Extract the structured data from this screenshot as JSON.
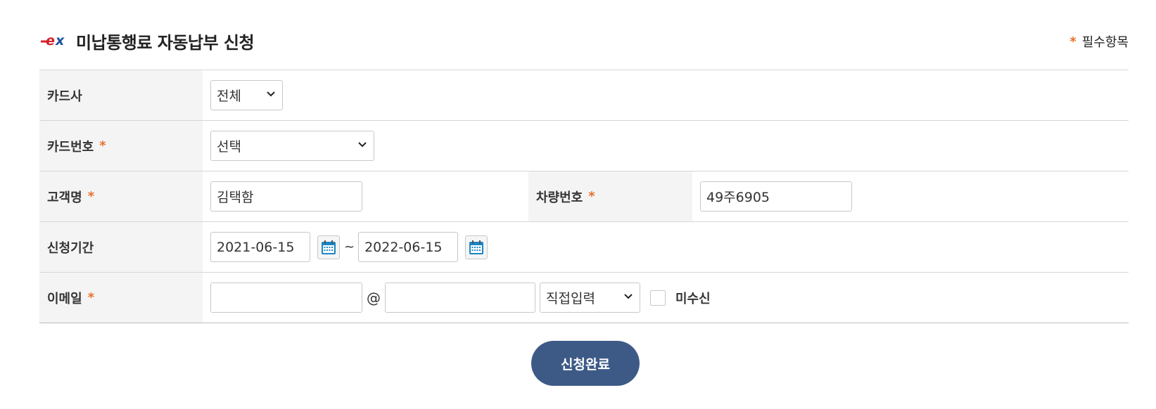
{
  "header": {
    "title": "미납통행료 자동납부 신청",
    "logo_text": "ex",
    "required_star": "*",
    "required_label": "필수항목"
  },
  "form": {
    "card_company": {
      "label": "카드사",
      "value": "전체"
    },
    "card_number": {
      "label": "카드번호",
      "required_star": "*",
      "value": "선택"
    },
    "customer_name": {
      "label": "고객명",
      "required_star": "*",
      "value": "김택함"
    },
    "vehicle_number": {
      "label": "차량번호",
      "required_star": "*",
      "value": "49주6905"
    },
    "period": {
      "label": "신청기간",
      "start": "2021-06-15",
      "separator": "~",
      "end": "2022-06-15"
    },
    "email": {
      "label": "이메일",
      "required_star": "*",
      "local_part": "",
      "at": "@",
      "domain": "",
      "domain_select": "직접입력",
      "no_receive_label": "미수신",
      "no_receive_checked": false
    }
  },
  "submit_label": "신청완료",
  "colors": {
    "accent_star": "#e8702a",
    "submit_bg": "#3d5a87",
    "label_bg": "#f4f4f4"
  }
}
